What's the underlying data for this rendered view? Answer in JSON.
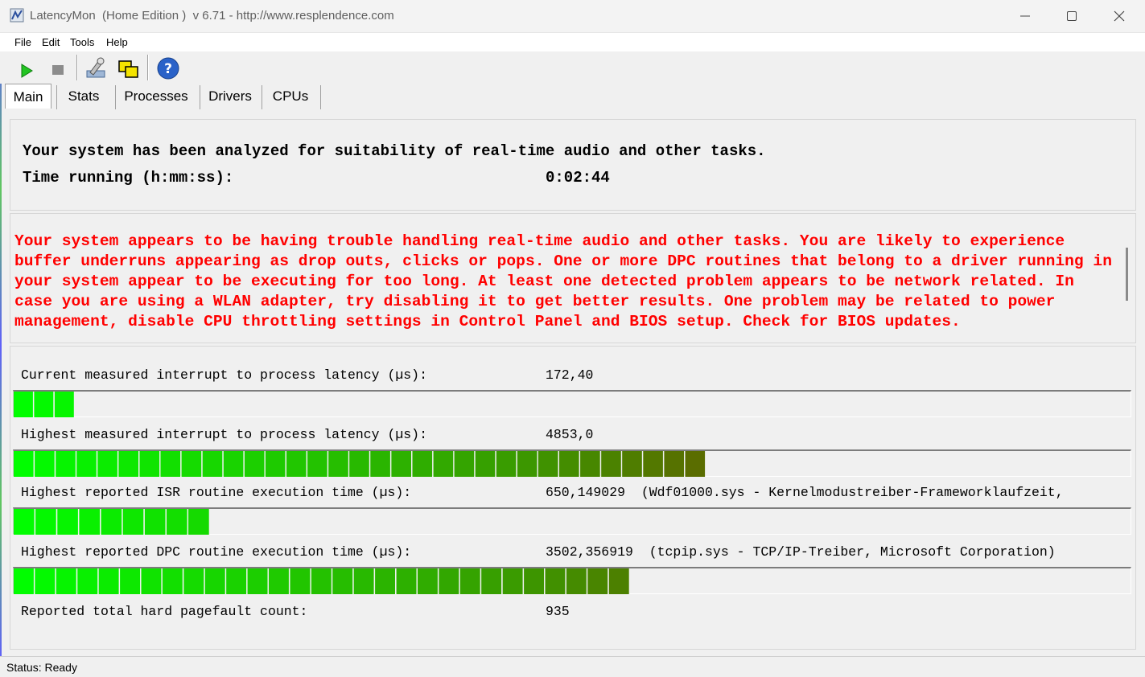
{
  "window": {
    "title": "LatencyMon  (Home Edition )  v 6.71 - http://www.resplendence.com",
    "controls": [
      "minimize-icon",
      "maximize-icon",
      "close-icon"
    ]
  },
  "menu": [
    "File",
    "Edit",
    "Tools",
    "Help"
  ],
  "toolbar": {
    "buttons": [
      "play-icon",
      "stop-icon",
      "wrench-icon",
      "copy-windows-icon",
      "help-icon"
    ]
  },
  "tabs": [
    "Main",
    "Stats",
    "Processes",
    "Drivers",
    "CPUs"
  ],
  "active_tab": "Main",
  "summary": {
    "analysis": "Your system has been analyzed for suitability of real-time audio and other tasks.",
    "time_label": "Time running (h:mm:ss):",
    "time_value": "0:02:44"
  },
  "warning": "Your system appears to be having trouble handling real-time audio and other tasks. You are likely to experience buffer underruns appearing as drop outs, clicks or pops. One or more DPC routines that belong to a driver running in your system appear to be executing for too long. At least one detected problem appears to be network related. In case you are using a WLAN adapter, try disabling it to get better results. One problem may be related to power management, disable CPU throttling settings in Control Panel and BIOS setup. Check for BIOS updates.",
  "metrics": [
    {
      "label": "Current measured interrupt to process latency (µs):",
      "value": "172,40"
    },
    {
      "label": "Highest measured interrupt to process latency (µs):",
      "value": "4853,0"
    },
    {
      "label": "Highest reported ISR routine execution time (µs):",
      "value": "650,149029  (Wdf01000.sys - Kernelmodustreiber-Frameworklaufzeit,"
    },
    {
      "label": "Highest reported DPC routine execution time (µs):",
      "value": "3502,356919  (tcpip.sys - TCP/IP-Treiber, Microsoft Corporation)"
    },
    {
      "label": "Reported total hard pagefault count:",
      "value": "935"
    }
  ],
  "bars": [
    {
      "fill_fraction": 0.055
    },
    {
      "fill_fraction": 0.62
    },
    {
      "fill_fraction": 0.176
    },
    {
      "fill_fraction": 0.552
    }
  ],
  "bar_colors": {
    "start": "#00ff00",
    "mid": "#3a9a00",
    "end": "#a80000"
  },
  "status": "Status: Ready"
}
